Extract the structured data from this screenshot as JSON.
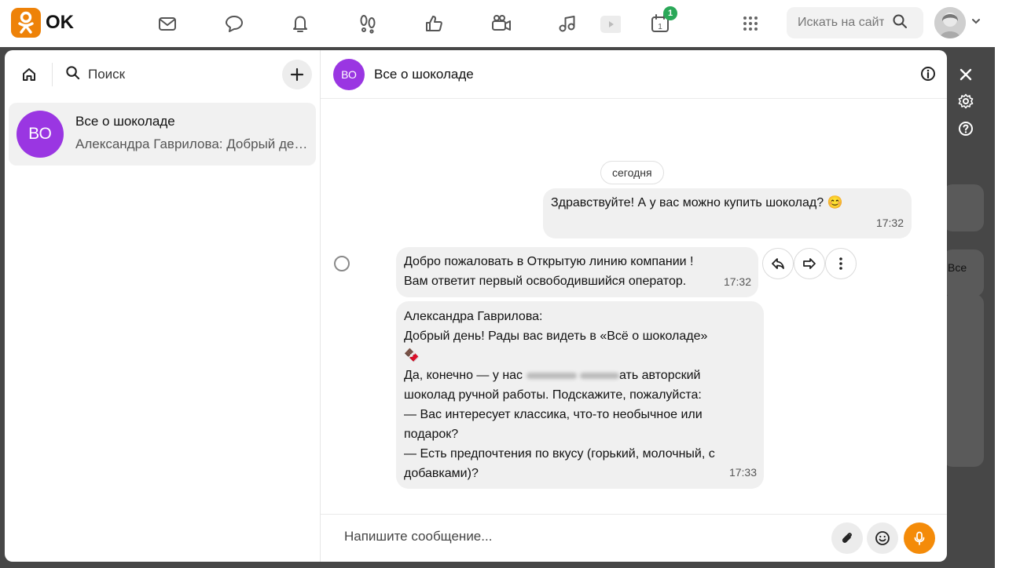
{
  "brand": {
    "logo_text": "OK",
    "accent": "#ee8208"
  },
  "header": {
    "nav_icons": [
      "mail-icon",
      "discussions-icon",
      "notifications-icon",
      "guests-icon",
      "likes-icon",
      "video-icon",
      "music-icon",
      "video-play-icon",
      "calendar-icon",
      "apps-grid-icon"
    ],
    "calendar_badge": "1",
    "search_placeholder": "Искать на сайте"
  },
  "left_panel": {
    "search_label": "Поиск",
    "conversations": [
      {
        "avatar_initials": "ВО",
        "title": "Все о шоколаде",
        "preview": "Александра Гаврилова: Добрый день! Рады вас видеть в «Всё о шоколаде»",
        "avatar_color": "#9a36e2"
      }
    ]
  },
  "chat": {
    "avatar_initials": "ВО",
    "title": "Все о шоколаде",
    "date_label": "сегодня",
    "messages": [
      {
        "direction": "out",
        "text": "Здравствуйте! А у вас можно купить шоколад? 😊",
        "time": "17:32"
      },
      {
        "direction": "in",
        "line1": "Добро пожаловать в Открытую линию компании !",
        "line2": "Вам ответит первый освободившийся оператор.",
        "time": "17:32"
      },
      {
        "direction": "in",
        "author": "Александра Гаврилова:",
        "l1": "Добрый день! Рады вас видеть в «Всё о шоколаде»",
        "emoji": "🍫",
        "l3a": "Да, конечно — у нас",
        "l3b": "ать авторский",
        "l4a": "шоколад ручной работы.",
        "l4b": "Подскажите, пожалуйста:",
        "l5": "— Вас интересует классика, что-то необычное или",
        "l6": "подарок?",
        "l7": "— Есть предпочтения по вкусу (горький, молочный, с",
        "l8": "добавками)?",
        "time": "17:33"
      }
    ],
    "composer_placeholder": "Напишите сообщение..."
  },
  "background_snippet": "Все"
}
